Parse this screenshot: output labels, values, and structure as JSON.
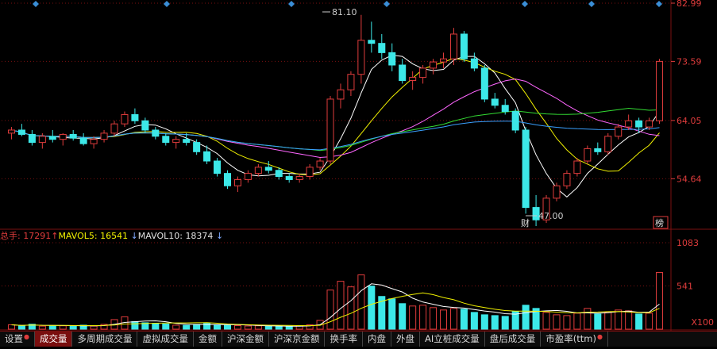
{
  "price_axis": {
    "labels": [
      "82.99",
      "73.59",
      "64.05",
      "54.64"
    ],
    "values": [
      82.99,
      73.59,
      64.05,
      54.64
    ],
    "min": 47.0,
    "max": 82.99,
    "color": "#e03c3c"
  },
  "annotations": {
    "high_label": "81.10",
    "low_label": "47.00",
    "financial_marker": "财",
    "ranking_marker": "榜"
  },
  "volume_header": {
    "total_label": "总手:",
    "total_value": "17291",
    "ma5_label": "MAVOL5:",
    "ma5_value": "16541",
    "ma10_label": "MAVOL10:",
    "ma10_value": "18374",
    "up_arrow": "↑",
    "down_arrow": "↓"
  },
  "volume_axis": {
    "labels": [
      "1083",
      "541"
    ],
    "values": [
      1083,
      541
    ],
    "unit_label": "X100"
  },
  "tabs": [
    {
      "label": "设置",
      "dot": true
    },
    {
      "label": "成交量",
      "active": true
    },
    {
      "label": "多周期成交量"
    },
    {
      "label": "虚拟成交量"
    },
    {
      "label": "金额"
    },
    {
      "label": "沪深金额"
    },
    {
      "label": "沪深京金额"
    },
    {
      "label": "换手率"
    },
    {
      "label": "内盘"
    },
    {
      "label": "外盘"
    },
    {
      "label": "AI立桩成交量"
    },
    {
      "label": "盘后成交量"
    },
    {
      "label": "市盈率(ttm)",
      "dot": true
    }
  ],
  "colors": {
    "up": "#e03c3c",
    "down": "#3ce8e8",
    "ma5": "#ffffff",
    "ma10": "#f0f000",
    "ma20": "#ff66ff",
    "ma30": "#33dd33",
    "ma60": "#3aa0ff",
    "grid": "#7a1010",
    "marker_diamond": "#3a8ed6"
  },
  "chart_data": {
    "type": "candlestick",
    "ohlc": [
      [
        62,
        63,
        61,
        62.5
      ],
      [
        62.5,
        63.5,
        61.5,
        61.8
      ],
      [
        61.8,
        62.5,
        60,
        60.5
      ],
      [
        60.5,
        62,
        59.5,
        61.5
      ],
      [
        61.5,
        62.5,
        60.5,
        61
      ],
      [
        61,
        62,
        60,
        61.8
      ],
      [
        61.8,
        62.5,
        60.8,
        61.2
      ],
      [
        61.2,
        62,
        60,
        60.3
      ],
      [
        60.3,
        61.5,
        59.5,
        61
      ],
      [
        61,
        62.5,
        60.5,
        62
      ],
      [
        62,
        64,
        61.5,
        63.5
      ],
      [
        63.5,
        65.5,
        63,
        65
      ],
      [
        65,
        66,
        63.5,
        64
      ],
      [
        64,
        64.5,
        62,
        62.5
      ],
      [
        62.5,
        63,
        61,
        61.5
      ],
      [
        61.5,
        62,
        60,
        60.5
      ],
      [
        60.5,
        61.5,
        59.5,
        61
      ],
      [
        61,
        62,
        60,
        60.5
      ],
      [
        60.5,
        61,
        58.5,
        59
      ],
      [
        59,
        60,
        57,
        57.5
      ],
      [
        57.5,
        58,
        55,
        55.5
      ],
      [
        55.5,
        56,
        53,
        53.5
      ],
      [
        53.5,
        55,
        52.5,
        54.5
      ],
      [
        54.5,
        56,
        54,
        55.5
      ],
      [
        55.5,
        57,
        55,
        56.5
      ],
      [
        56.5,
        57.5,
        55.5,
        56
      ],
      [
        56,
        56.5,
        54.5,
        55
      ],
      [
        55,
        55.5,
        54,
        54.5
      ],
      [
        54.5,
        55.5,
        54,
        55
      ],
      [
        55,
        57,
        54.5,
        56.5
      ],
      [
        56.5,
        58,
        56,
        57.5
      ],
      [
        57.5,
        68,
        57,
        67.5
      ],
      [
        67.5,
        70,
        66,
        69
      ],
      [
        69,
        72,
        68,
        71.5
      ],
      [
        71.5,
        81.1,
        70,
        77
      ],
      [
        77,
        80,
        75,
        76.5
      ],
      [
        76.5,
        78,
        74,
        75
      ],
      [
        75,
        76.5,
        72,
        73
      ],
      [
        73,
        74,
        70,
        70.5
      ],
      [
        70.5,
        72,
        69,
        71
      ],
      [
        71,
        73,
        70,
        72.5
      ],
      [
        72.5,
        74,
        71.5,
        73.5
      ],
      [
        73.5,
        75,
        72.5,
        74
      ],
      [
        74,
        79,
        73,
        78
      ],
      [
        78,
        78.5,
        73.5,
        74
      ],
      [
        74,
        75,
        72,
        72.5
      ],
      [
        72.5,
        73,
        67,
        67.5
      ],
      [
        67.5,
        68.5,
        66,
        66.5
      ],
      [
        66.5,
        67.5,
        65,
        65.5
      ],
      [
        65.5,
        66,
        62,
        62.5
      ],
      [
        62.5,
        63,
        49,
        50
      ],
      [
        50,
        52,
        47,
        48
      ],
      [
        48,
        52,
        47.5,
        51.5
      ],
      [
        51.5,
        54,
        51,
        53.5
      ],
      [
        53.5,
        56,
        53,
        55.5
      ],
      [
        55.5,
        58,
        55,
        57.5
      ],
      [
        57.5,
        60,
        57,
        59.5
      ],
      [
        59.5,
        60.5,
        58.5,
        59
      ],
      [
        59,
        62,
        58.5,
        61.5
      ],
      [
        61.5,
        63.5,
        61,
        63
      ],
      [
        63,
        65,
        62.5,
        64
      ],
      [
        64,
        64.5,
        62,
        63
      ],
      [
        63,
        64.5,
        62.5,
        64
      ],
      [
        64,
        74,
        63.5,
        73.59
      ]
    ],
    "volume": [
      55,
      40,
      62,
      38,
      45,
      42,
      35,
      50,
      38,
      60,
      120,
      155,
      95,
      80,
      70,
      65,
      50,
      48,
      60,
      72,
      55,
      48,
      45,
      40,
      42,
      38,
      35,
      36,
      40,
      55,
      110,
      490,
      600,
      530,
      680,
      540,
      410,
      380,
      320,
      290,
      300,
      270,
      240,
      260,
      250,
      210,
      180,
      170,
      160,
      220,
      300,
      260,
      210,
      180,
      170,
      200,
      260,
      190,
      210,
      240,
      230,
      190,
      200,
      710
    ],
    "ma": {
      "ma5": "white",
      "ma10": "yellow",
      "ma20": "magenta",
      "ma30": "green",
      "ma60": "blue"
    },
    "ylim": [
      47.0,
      82.99
    ],
    "vol_ylim": [
      0,
      1083
    ]
  }
}
